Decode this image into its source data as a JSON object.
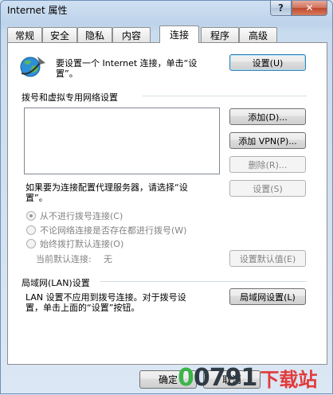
{
  "window": {
    "title": "Internet 属性"
  },
  "titlebar": {
    "help_glyph": "?",
    "close_glyph": "✕"
  },
  "tabs": [
    {
      "label": "常规",
      "active": false
    },
    {
      "label": "安全",
      "active": false
    },
    {
      "label": "隐私",
      "active": false
    },
    {
      "label": "内容",
      "active": false
    },
    {
      "label": "连接",
      "active": true
    },
    {
      "label": "程序",
      "active": false
    },
    {
      "label": "高级",
      "active": false
    }
  ],
  "setup": {
    "line1": "要设置一个 Internet 连接，单击“设",
    "line2": "置”。",
    "button": "设置(U)"
  },
  "dialup": {
    "heading": "拨号和虚拟专用网络设置",
    "add_button": "添加(D)...",
    "add_vpn_button": "添加 VPN(P)...",
    "remove_button": "删除(R)...",
    "proxy_line1": "如果要为连接配置代理服务器，请选择“设",
    "proxy_line2": "置”。",
    "settings_button": "设置(S)",
    "radios": [
      {
        "label": "从不进行拨号连接(C)",
        "checked": true
      },
      {
        "label": "不论网络连接是否存在都进行拨号(W)",
        "checked": false
      },
      {
        "label": "始终拨打默认连接(O)",
        "checked": false
      }
    ],
    "current_default_label": "当前默认连接:",
    "current_default_value": "无",
    "set_default_button": "设置默认值(E)"
  },
  "lan": {
    "heading": "局域网(LAN)设置",
    "line1": "LAN 设置不应用到拨号连接。对于拨号设",
    "line2": "置，单击上面的“设置”按钮。",
    "button": "局域网设置(L)"
  },
  "footer": {
    "ok": "确定",
    "cancel": "取消"
  },
  "watermark": {
    "a": "0",
    "b": "0",
    "c": "791",
    "text": "下载站"
  }
}
